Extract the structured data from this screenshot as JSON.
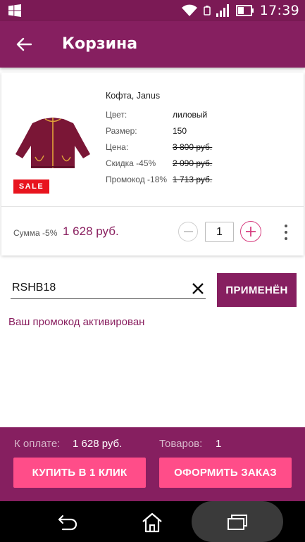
{
  "status_bar": {
    "time": "17:39"
  },
  "app_bar": {
    "title": "Корзина"
  },
  "product": {
    "name": "Кофта, Janus",
    "badge": "SALE",
    "attributes": [
      {
        "label": "Цвет:",
        "value": "лиловый",
        "struck": false
      },
      {
        "label": "Размер:",
        "value": "150",
        "struck": false
      },
      {
        "label": "Цена:",
        "value": "3 800 руб.",
        "struck": true
      },
      {
        "label": "Скидка -45%",
        "value": "2 090 руб.",
        "struck": true
      },
      {
        "label": "Промокод -18%",
        "value": "1 713 руб.",
        "struck": true
      }
    ],
    "sum_label": "Сумма -5%",
    "sum_value": "1 628 руб.",
    "quantity": "1"
  },
  "promo": {
    "code": "RSHB18",
    "apply_label": "ПРИМЕНЁН",
    "message": "Ваш промокод активирован"
  },
  "summary": {
    "pay_label": "К оплате:",
    "pay_value": "1 628 руб.",
    "items_label": "Товаров:",
    "items_value": "1"
  },
  "actions": {
    "buy_one_click": "КУПИТЬ В 1 КЛИК",
    "checkout": "ОФОРМИТЬ ЗАКАЗ"
  },
  "colors": {
    "primary": "#861f60",
    "status_bar": "#7b1a55",
    "accent_pink": "#ff4d89",
    "price_text": "#8a2060",
    "sale_red": "#e8141e"
  },
  "icons": {
    "back": "arrow-left-icon",
    "clear": "close-icon",
    "minus": "minus-circle-icon",
    "plus": "plus-circle-icon",
    "more": "more-vertical-icon"
  }
}
